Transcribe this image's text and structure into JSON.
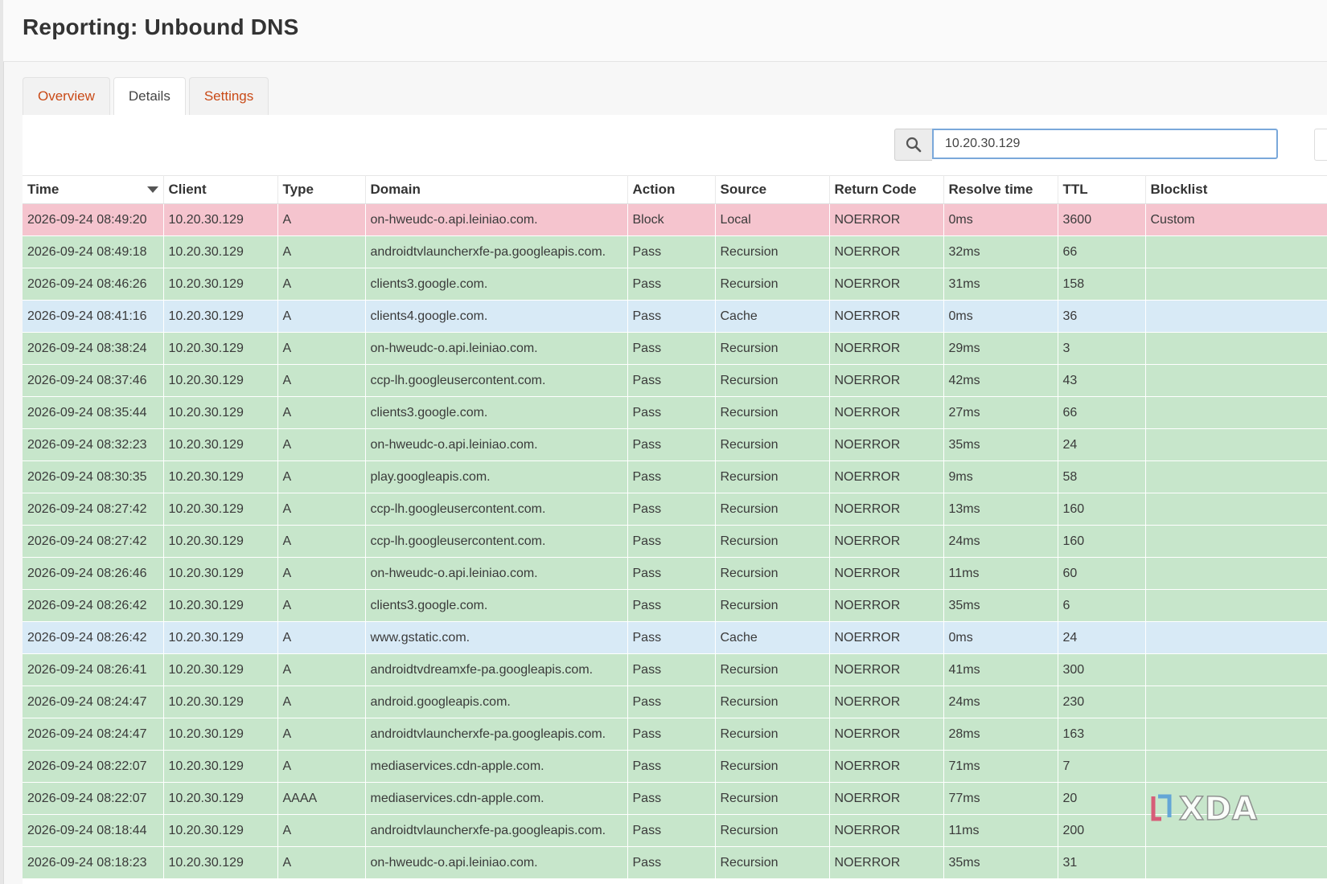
{
  "page": {
    "title": "Reporting: Unbound DNS"
  },
  "tabs": [
    {
      "label": "Overview",
      "active": false
    },
    {
      "label": "Details",
      "active": true
    },
    {
      "label": "Settings",
      "active": false
    }
  ],
  "search": {
    "value": "10.20.30.129",
    "icon": "search-icon"
  },
  "table": {
    "columns": [
      "Time",
      "Client",
      "Type",
      "Domain",
      "Action",
      "Source",
      "Return Code",
      "Resolve time",
      "TTL",
      "Blocklist"
    ],
    "sort": {
      "column": "Time",
      "icon": "caret-down-icon"
    },
    "rows": [
      [
        "2026-09-24 08:49:20",
        "10.20.30.129",
        "A",
        "on-hweudc-o.api.leiniao.com.",
        "Block",
        "Local",
        "NOERROR",
        "0ms",
        "3600",
        "Custom"
      ],
      [
        "2026-09-24 08:49:18",
        "10.20.30.129",
        "A",
        "androidtvlauncherxfe-pa.googleapis.com.",
        "Pass",
        "Recursion",
        "NOERROR",
        "32ms",
        "66",
        ""
      ],
      [
        "2026-09-24 08:46:26",
        "10.20.30.129",
        "A",
        "clients3.google.com.",
        "Pass",
        "Recursion",
        "NOERROR",
        "31ms",
        "158",
        ""
      ],
      [
        "2026-09-24 08:41:16",
        "10.20.30.129",
        "A",
        "clients4.google.com.",
        "Pass",
        "Cache",
        "NOERROR",
        "0ms",
        "36",
        ""
      ],
      [
        "2026-09-24 08:38:24",
        "10.20.30.129",
        "A",
        "on-hweudc-o.api.leiniao.com.",
        "Pass",
        "Recursion",
        "NOERROR",
        "29ms",
        "3",
        ""
      ],
      [
        "2026-09-24 08:37:46",
        "10.20.30.129",
        "A",
        "ccp-lh.googleusercontent.com.",
        "Pass",
        "Recursion",
        "NOERROR",
        "42ms",
        "43",
        ""
      ],
      [
        "2026-09-24 08:35:44",
        "10.20.30.129",
        "A",
        "clients3.google.com.",
        "Pass",
        "Recursion",
        "NOERROR",
        "27ms",
        "66",
        ""
      ],
      [
        "2026-09-24 08:32:23",
        "10.20.30.129",
        "A",
        "on-hweudc-o.api.leiniao.com.",
        "Pass",
        "Recursion",
        "NOERROR",
        "35ms",
        "24",
        ""
      ],
      [
        "2026-09-24 08:30:35",
        "10.20.30.129",
        "A",
        "play.googleapis.com.",
        "Pass",
        "Recursion",
        "NOERROR",
        "9ms",
        "58",
        ""
      ],
      [
        "2026-09-24 08:27:42",
        "10.20.30.129",
        "A",
        "ccp-lh.googleusercontent.com.",
        "Pass",
        "Recursion",
        "NOERROR",
        "13ms",
        "160",
        ""
      ],
      [
        "2026-09-24 08:27:42",
        "10.20.30.129",
        "A",
        "ccp-lh.googleusercontent.com.",
        "Pass",
        "Recursion",
        "NOERROR",
        "24ms",
        "160",
        ""
      ],
      [
        "2026-09-24 08:26:46",
        "10.20.30.129",
        "A",
        "on-hweudc-o.api.leiniao.com.",
        "Pass",
        "Recursion",
        "NOERROR",
        "11ms",
        "60",
        ""
      ],
      [
        "2026-09-24 08:26:42",
        "10.20.30.129",
        "A",
        "clients3.google.com.",
        "Pass",
        "Recursion",
        "NOERROR",
        "35ms",
        "6",
        ""
      ],
      [
        "2026-09-24 08:26:42",
        "10.20.30.129",
        "A",
        "www.gstatic.com.",
        "Pass",
        "Cache",
        "NOERROR",
        "0ms",
        "24",
        ""
      ],
      [
        "2026-09-24 08:26:41",
        "10.20.30.129",
        "A",
        "androidtvdreamxfe-pa.googleapis.com.",
        "Pass",
        "Recursion",
        "NOERROR",
        "41ms",
        "300",
        ""
      ],
      [
        "2026-09-24 08:24:47",
        "10.20.30.129",
        "A",
        "android.googleapis.com.",
        "Pass",
        "Recursion",
        "NOERROR",
        "24ms",
        "230",
        ""
      ],
      [
        "2026-09-24 08:24:47",
        "10.20.30.129",
        "A",
        "androidtvlauncherxfe-pa.googleapis.com.",
        "Pass",
        "Recursion",
        "NOERROR",
        "28ms",
        "163",
        ""
      ],
      [
        "2026-09-24 08:22:07",
        "10.20.30.129",
        "A",
        "mediaservices.cdn-apple.com.",
        "Pass",
        "Recursion",
        "NOERROR",
        "71ms",
        "7",
        ""
      ],
      [
        "2026-09-24 08:22:07",
        "10.20.30.129",
        "AAAA",
        "mediaservices.cdn-apple.com.",
        "Pass",
        "Recursion",
        "NOERROR",
        "77ms",
        "20",
        ""
      ],
      [
        "2026-09-24 08:18:44",
        "10.20.30.129",
        "A",
        "androidtvlauncherxfe-pa.googleapis.com.",
        "Pass",
        "Recursion",
        "NOERROR",
        "11ms",
        "200",
        ""
      ],
      [
        "2026-09-24 08:18:23",
        "10.20.30.129",
        "A",
        "on-hweudc-o.api.leiniao.com.",
        "Pass",
        "Recursion",
        "NOERROR",
        "35ms",
        "31",
        ""
      ]
    ]
  },
  "colors": {
    "accent": "#c94a17",
    "row_pass": "#c7e6cb",
    "row_block": "#f5c4ce",
    "row_cache": "#d8eaf6"
  },
  "watermark": {
    "text": "XDA",
    "icon": "xda-logo-icon"
  }
}
